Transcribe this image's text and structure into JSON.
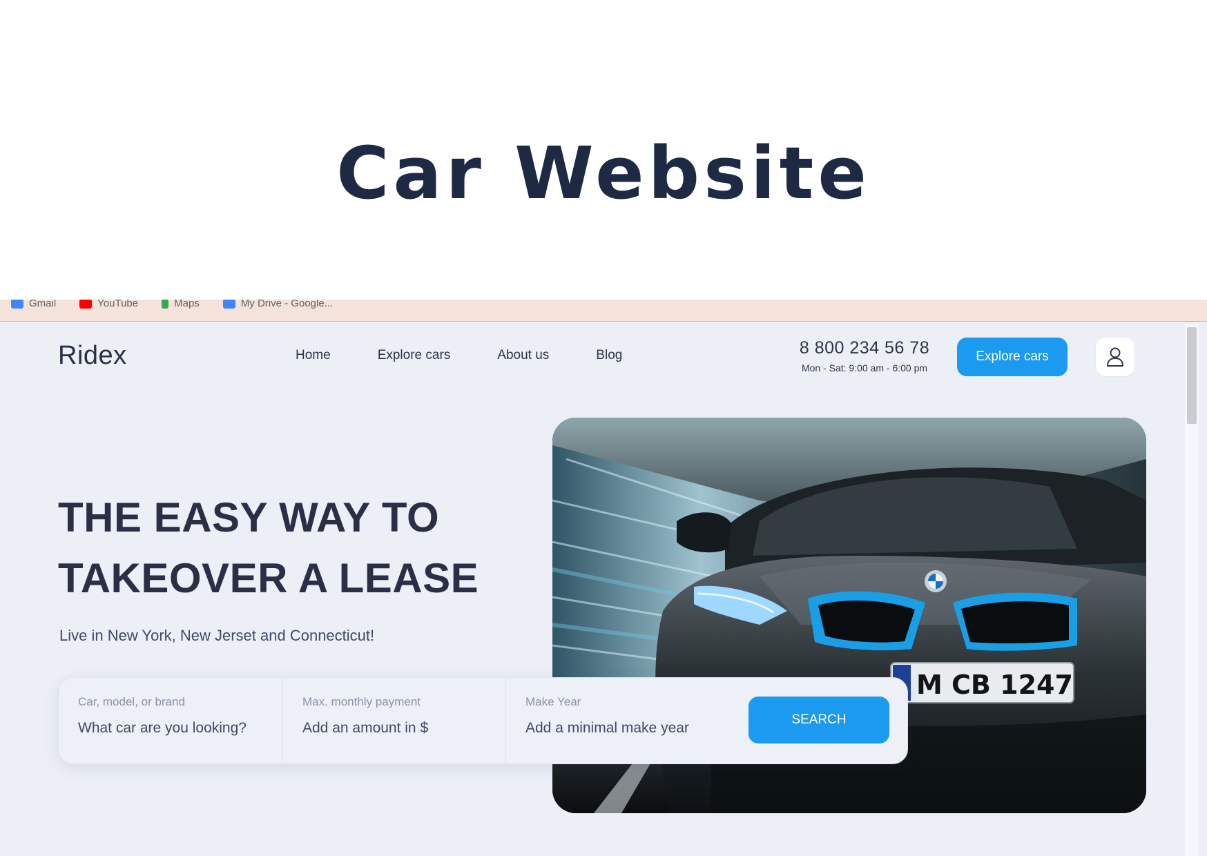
{
  "banner": {
    "title": "Car Website"
  },
  "bookmarks": [
    {
      "label": "Gmail",
      "color": "#4285f4"
    },
    {
      "label": "YouTube",
      "color": "#ff0000"
    },
    {
      "label": "Maps",
      "color": "#34a853"
    },
    {
      "label": "My Drive - Google...",
      "color": "#4285f4"
    }
  ],
  "header": {
    "logo": "Ridex",
    "nav": [
      "Home",
      "Explore cars",
      "About us",
      "Blog"
    ],
    "phone": "8 800 234 56 78",
    "hours": "Mon - Sat: 9:00 am - 6:00 pm",
    "cta": "Explore cars",
    "user_icon": "user-icon"
  },
  "hero": {
    "title_line1": "THE EASY WAY TO",
    "title_line2": "TAKEOVER A LEASE",
    "subtitle": "Live in New York, New Jerset and Connecticut!"
  },
  "image": {
    "plate": "M CB 1247"
  },
  "search": {
    "fields": [
      {
        "label": "Car, model, or brand",
        "placeholder": "What car are you looking?"
      },
      {
        "label": "Max. monthly payment",
        "placeholder": "Add an amount in $"
      },
      {
        "label": "Make Year",
        "placeholder": "Add a minimal make year"
      }
    ],
    "button": "SEARCH"
  },
  "colors": {
    "accent": "#1b9af0",
    "text_dark": "#2b2f45",
    "background": "#eceff6"
  }
}
